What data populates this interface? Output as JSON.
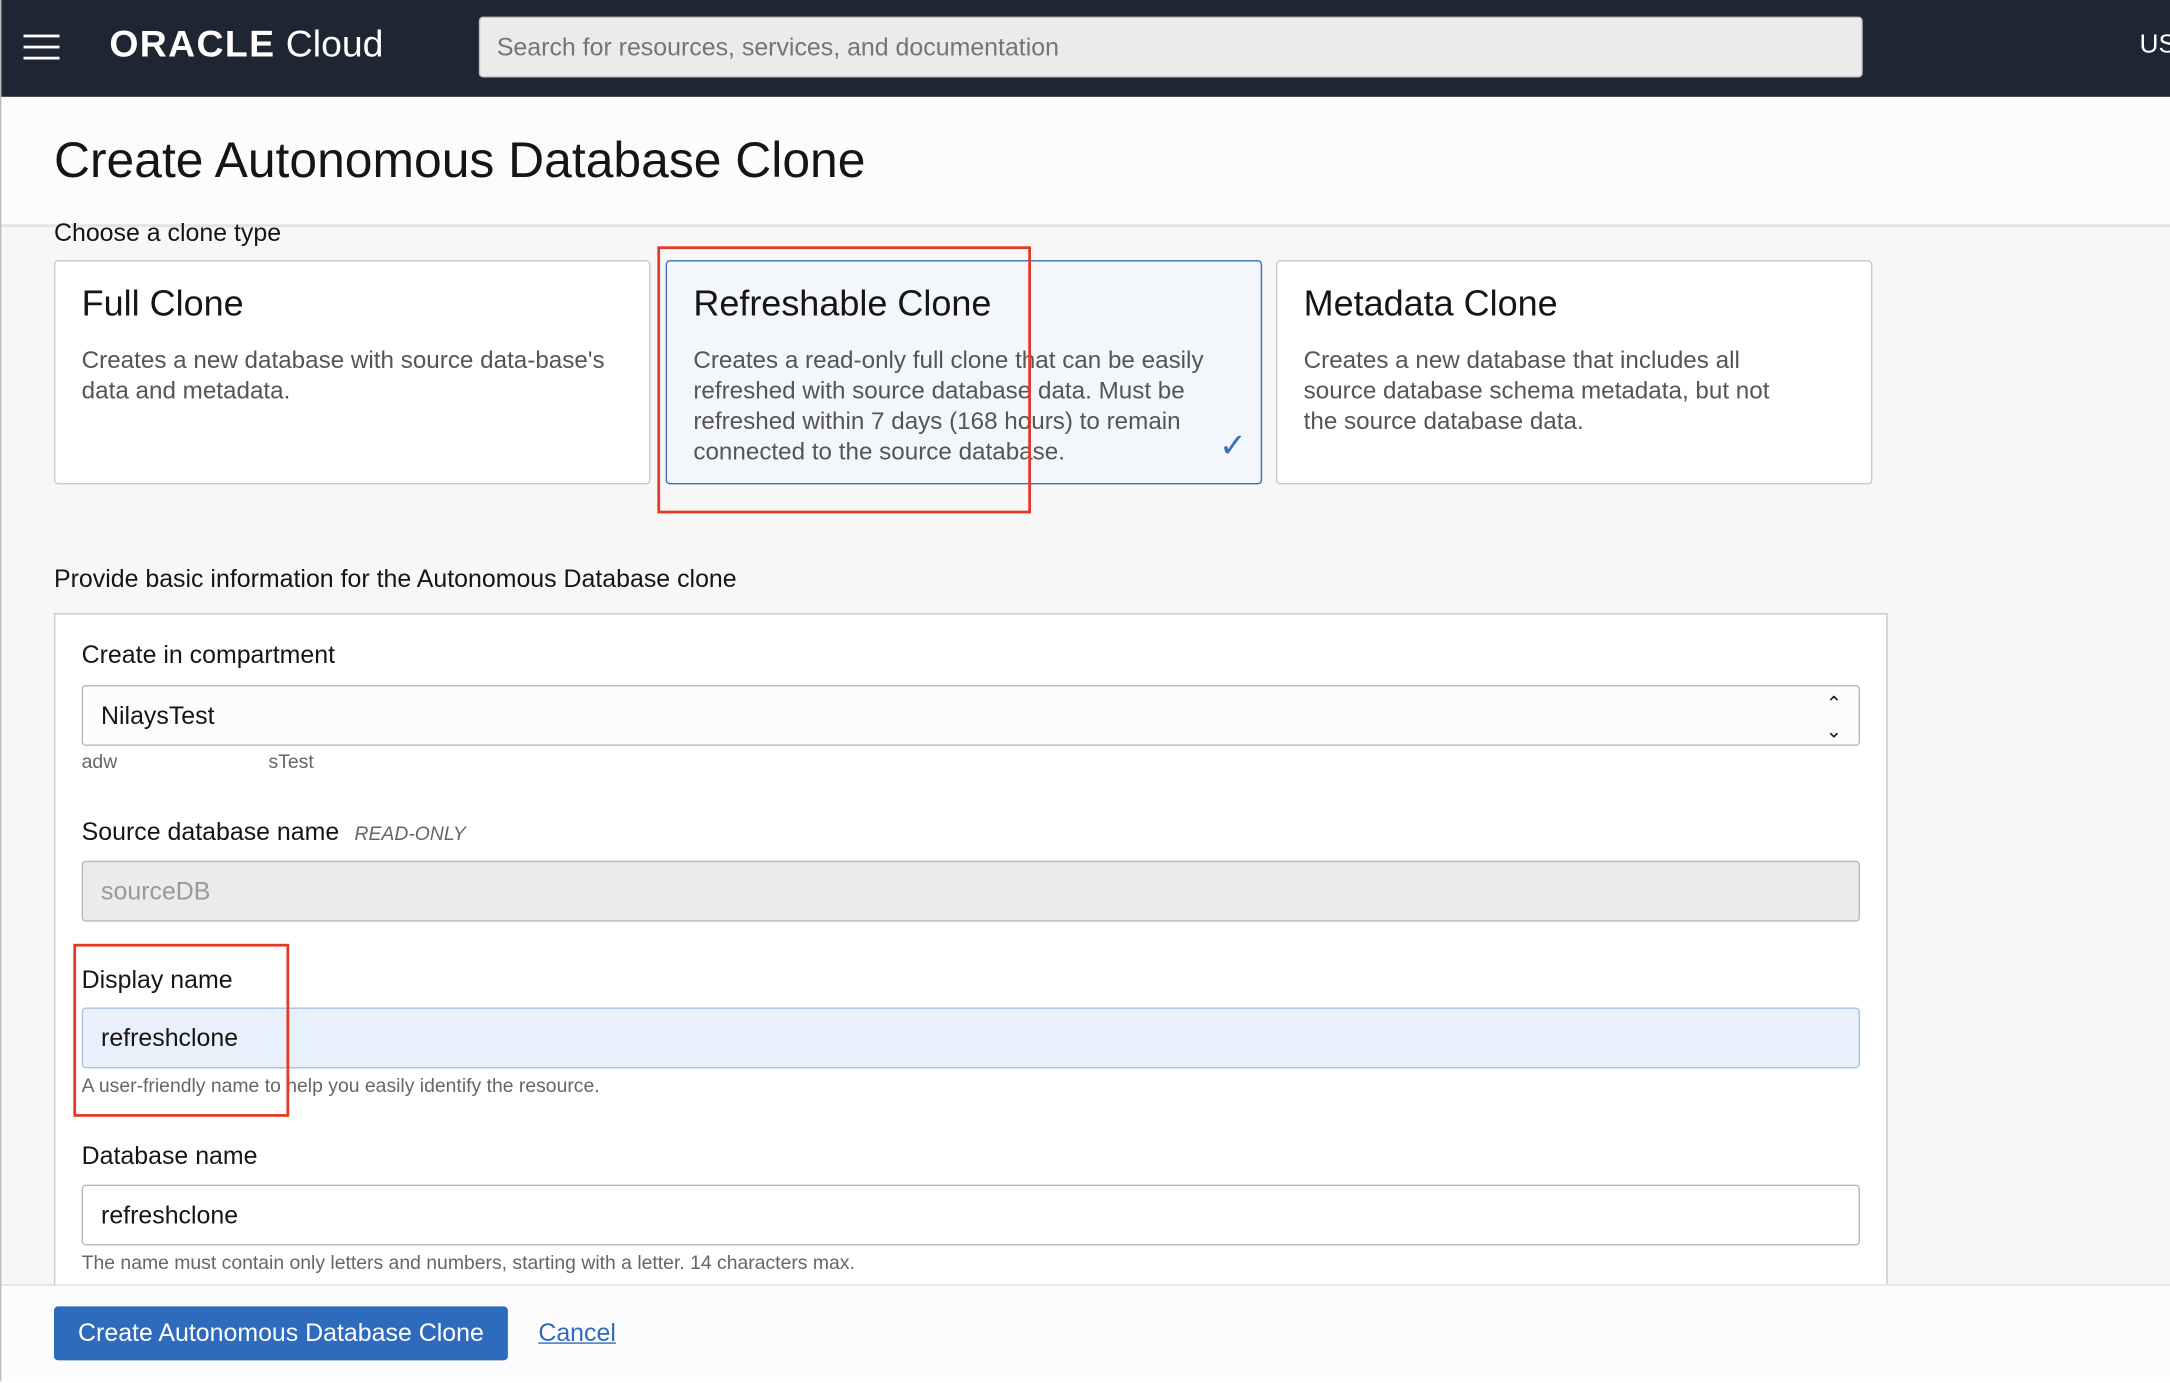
{
  "topbar": {
    "logo_brand": "ORACLE",
    "logo_product": "Cloud",
    "search_placeholder": "Search for resources, services, and documentation",
    "region": "US"
  },
  "page": {
    "title": "Create Autonomous Database Clone",
    "clone_type_label": "Choose a clone type"
  },
  "clone_types": [
    {
      "title": "Full Clone",
      "description": "Creates a new database with source data-base's data and metadata.",
      "selected": false
    },
    {
      "title": "Refreshable Clone",
      "description": "Creates a read-only full clone that can be easily refreshed with source database data. Must be refreshed within 7 days (168 hours) to remain connected to the source database.",
      "selected": true
    },
    {
      "title": "Metadata Clone",
      "description": "Creates a new database that includes all source database schema metadata, but not the source database data.",
      "selected": false
    }
  ],
  "form": {
    "section_label": "Provide basic information for the Autonomous Database clone",
    "compartment": {
      "label": "Create in compartment",
      "value": "NilaysTest",
      "path_left": "adw",
      "path_right": "sTest"
    },
    "source_db": {
      "label": "Source database name",
      "badge": "READ-ONLY",
      "value": "sourceDB"
    },
    "display_name": {
      "label": "Display name",
      "value": "refreshclone",
      "help": "A user-friendly name to help you easily identify the resource."
    },
    "database_name": {
      "label": "Database name",
      "value": "refreshclone",
      "help": "The name must contain only letters and numbers, starting with a letter. 14 characters max."
    }
  },
  "footer": {
    "create_label": "Create Autonomous Database Clone",
    "cancel_label": "Cancel"
  },
  "colors": {
    "topbar": "#1f2633",
    "accent": "#2f6bbd",
    "highlight": "#e23a25"
  }
}
